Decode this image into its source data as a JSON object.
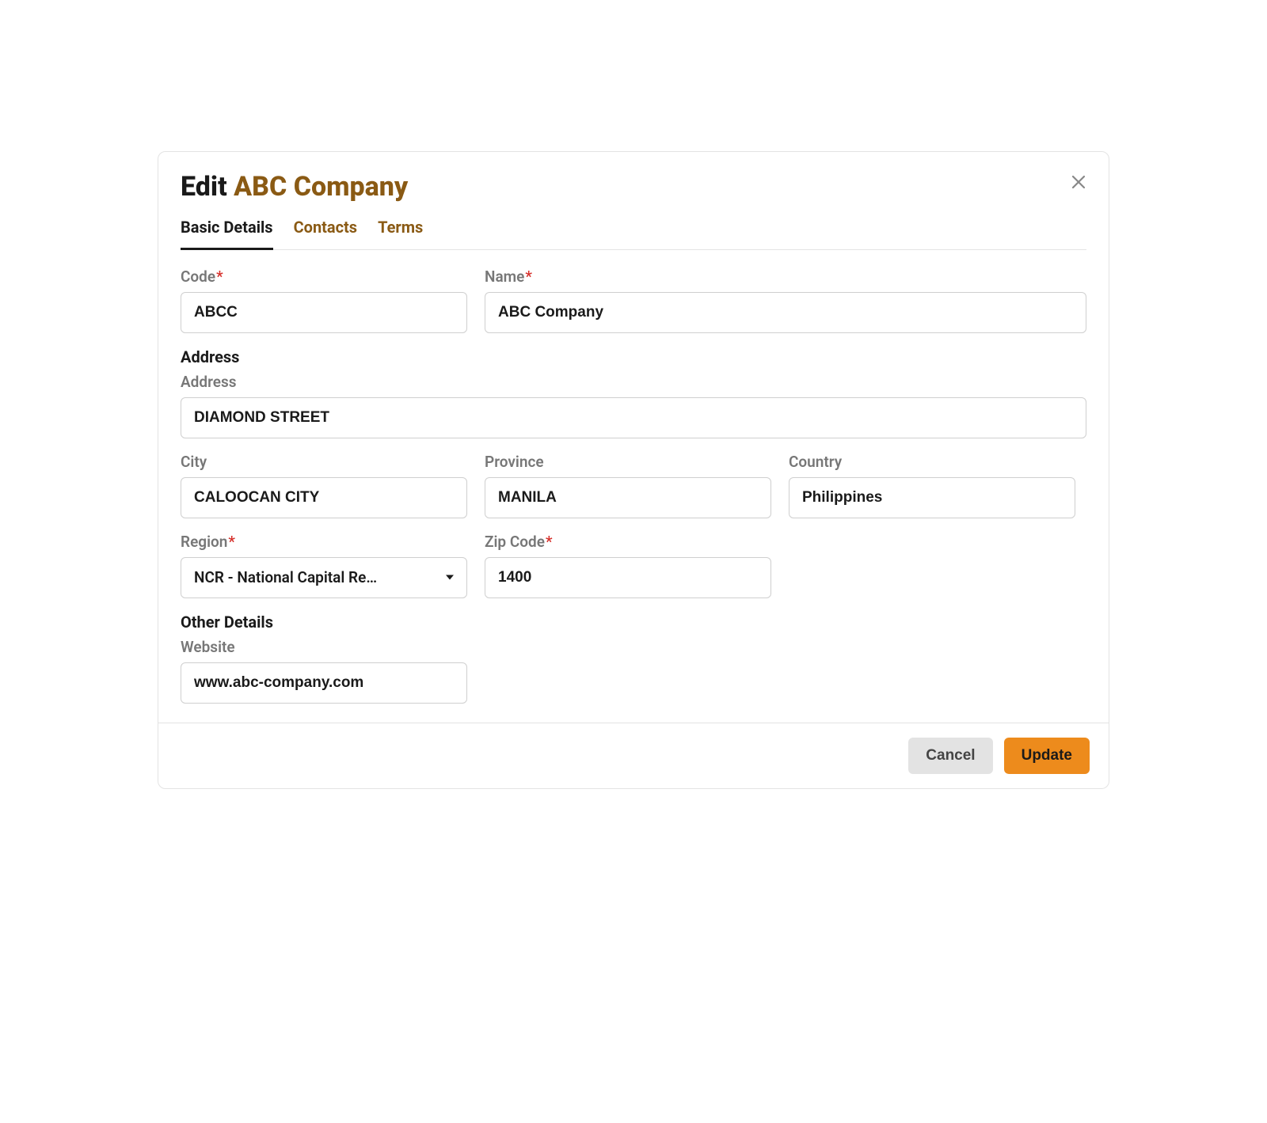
{
  "header": {
    "title_prefix": "Edit ",
    "company_name": "ABC Company"
  },
  "tabs": [
    {
      "label": "Basic Details",
      "active": true
    },
    {
      "label": "Contacts",
      "active": false
    },
    {
      "label": "Terms",
      "active": false
    }
  ],
  "labels": {
    "code": "Code",
    "name": "Name",
    "address_section": "Address",
    "address": "Address",
    "city": "City",
    "province": "Province",
    "country": "Country",
    "region": "Region",
    "zip": "Zip Code",
    "other_section": "Other Details",
    "website": "Website",
    "required_mark": "*"
  },
  "values": {
    "code": "ABCC",
    "name": "ABC Company",
    "address": "DIAMOND STREET",
    "city": "CALOOCAN CITY",
    "province": "MANILA",
    "country": "Philippines",
    "region": "NCR - National Capital Re…",
    "zip": "1400",
    "website": "www.abc-company.com"
  },
  "footer": {
    "cancel": "Cancel",
    "update": "Update"
  }
}
